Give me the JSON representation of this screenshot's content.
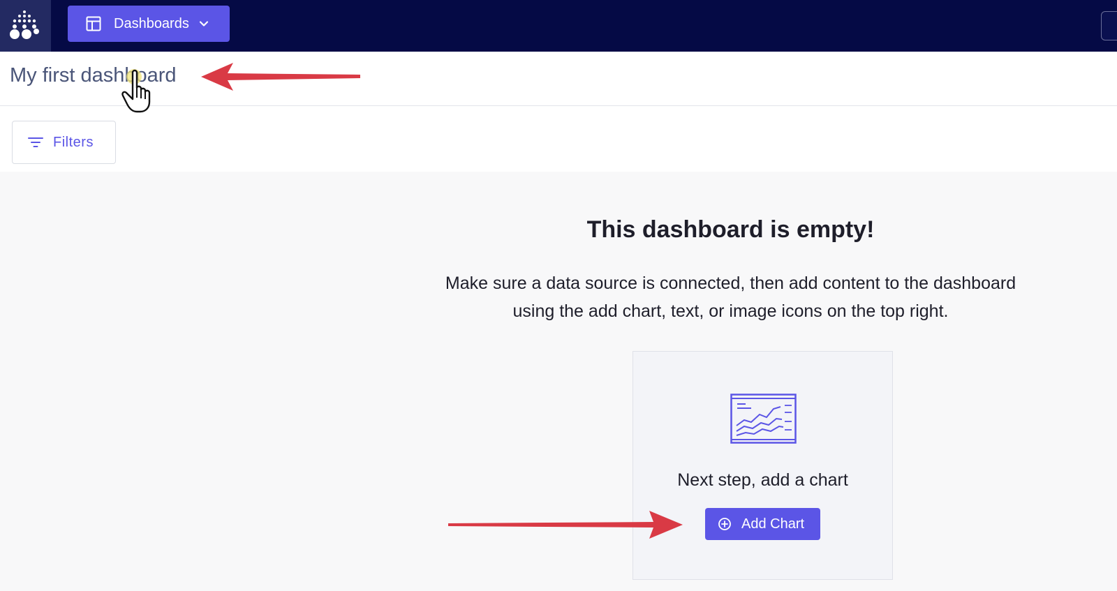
{
  "topbar": {
    "dashboards_label": "Dashboards"
  },
  "page": {
    "title": "My first dashboard"
  },
  "filters": {
    "label": "Filters"
  },
  "empty_state": {
    "heading": "This dashboard is empty!",
    "description": "Make sure a data source is connected, then add content to the dashboard using the add chart, text, or image icons on the top right.",
    "card_label": "Next step, add a chart",
    "add_chart_label": "Add Chart"
  },
  "colors": {
    "topbar_bg": "#050a45",
    "accent": "#5b55e6",
    "annotation_arrow": "#d93a45"
  },
  "icons": {
    "logo": "dot-grid-logo-icon",
    "dashboards": "layout-icon",
    "dropdown": "chevron-down-icon",
    "filters": "filter-lines-icon",
    "chart": "line-chart-illustration-icon",
    "add": "plus-circle-icon",
    "cursor": "hand-pointer-icon"
  }
}
